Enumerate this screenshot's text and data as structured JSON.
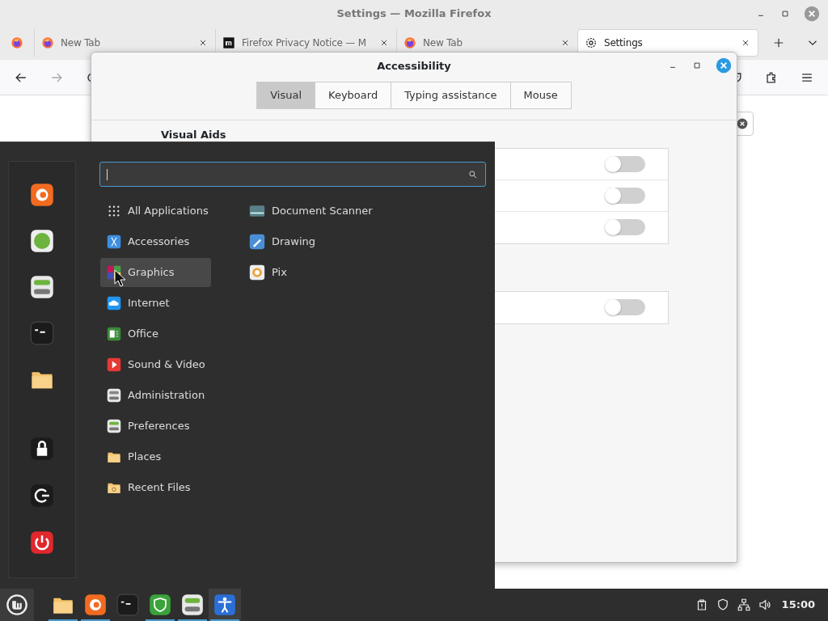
{
  "firefox": {
    "title": "Settings — Mozilla Firefox",
    "tabs": [
      {
        "label": "New Tab",
        "kind": "firefox",
        "selected": false
      },
      {
        "label": "Firefox Privacy Notice — M",
        "kind": "notice",
        "selected": false
      },
      {
        "label": "New Tab",
        "kind": "firefox",
        "selected": false
      },
      {
        "label": "Settings",
        "kind": "settings",
        "selected": true
      }
    ]
  },
  "dialog": {
    "title": "Accessibility",
    "tabs": [
      {
        "label": "Visual",
        "selected": true
      },
      {
        "label": "Keyboard",
        "selected": false
      },
      {
        "label": "Typing assistance",
        "selected": false
      },
      {
        "label": "Mouse",
        "selected": false
      }
    ],
    "section": "Visual Aids",
    "groups": [
      {
        "toggles": [
          {
            "on": false
          },
          {
            "on": false
          },
          {
            "on": false
          }
        ]
      },
      {
        "toggles": [
          {
            "on": false
          }
        ]
      }
    ]
  },
  "menu": {
    "categories": [
      {
        "label": "All Applications",
        "kind": "all",
        "selected": false
      },
      {
        "label": "Accessories",
        "kind": "accessories",
        "selected": false
      },
      {
        "label": "Graphics",
        "kind": "graphics",
        "selected": true
      },
      {
        "label": "Internet",
        "kind": "internet",
        "selected": false
      },
      {
        "label": "Office",
        "kind": "office",
        "selected": false
      },
      {
        "label": "Sound & Video",
        "kind": "media",
        "selected": false
      },
      {
        "label": "Administration",
        "kind": "admin",
        "selected": false
      },
      {
        "label": "Preferences",
        "kind": "prefs",
        "selected": false
      },
      {
        "label": "Places",
        "kind": "folder",
        "selected": false
      },
      {
        "label": "Recent Files",
        "kind": "recent",
        "selected": false
      }
    ],
    "apps": [
      {
        "label": "Document Scanner",
        "kind": "scanner"
      },
      {
        "label": "Drawing",
        "kind": "drawing"
      },
      {
        "label": "Pix",
        "kind": "pix"
      }
    ]
  },
  "taskbar": {
    "apps": [
      {
        "kind": "folder",
        "running": true,
        "selected": false
      },
      {
        "kind": "firefox",
        "running": true,
        "selected": false
      },
      {
        "kind": "terminal",
        "running": false,
        "selected": false
      },
      {
        "kind": "shield",
        "running": true,
        "selected": false
      },
      {
        "kind": "prefs",
        "running": true,
        "selected": false
      },
      {
        "kind": "a11y",
        "running": true,
        "selected": true
      }
    ],
    "clock": "15:00"
  }
}
